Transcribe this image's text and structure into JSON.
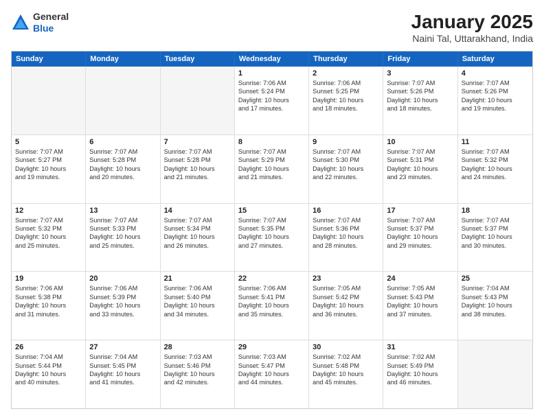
{
  "logo": {
    "general": "General",
    "blue": "Blue"
  },
  "title": "January 2025",
  "subtitle": "Naini Tal, Uttarakhand, India",
  "days": [
    "Sunday",
    "Monday",
    "Tuesday",
    "Wednesday",
    "Thursday",
    "Friday",
    "Saturday"
  ],
  "weeks": [
    [
      {
        "day": "",
        "lines": []
      },
      {
        "day": "",
        "lines": []
      },
      {
        "day": "",
        "lines": []
      },
      {
        "day": "1",
        "lines": [
          "Sunrise: 7:06 AM",
          "Sunset: 5:24 PM",
          "Daylight: 10 hours",
          "and 17 minutes."
        ]
      },
      {
        "day": "2",
        "lines": [
          "Sunrise: 7:06 AM",
          "Sunset: 5:25 PM",
          "Daylight: 10 hours",
          "and 18 minutes."
        ]
      },
      {
        "day": "3",
        "lines": [
          "Sunrise: 7:07 AM",
          "Sunset: 5:26 PM",
          "Daylight: 10 hours",
          "and 18 minutes."
        ]
      },
      {
        "day": "4",
        "lines": [
          "Sunrise: 7:07 AM",
          "Sunset: 5:26 PM",
          "Daylight: 10 hours",
          "and 19 minutes."
        ]
      }
    ],
    [
      {
        "day": "5",
        "lines": [
          "Sunrise: 7:07 AM",
          "Sunset: 5:27 PM",
          "Daylight: 10 hours",
          "and 19 minutes."
        ]
      },
      {
        "day": "6",
        "lines": [
          "Sunrise: 7:07 AM",
          "Sunset: 5:28 PM",
          "Daylight: 10 hours",
          "and 20 minutes."
        ]
      },
      {
        "day": "7",
        "lines": [
          "Sunrise: 7:07 AM",
          "Sunset: 5:28 PM",
          "Daylight: 10 hours",
          "and 21 minutes."
        ]
      },
      {
        "day": "8",
        "lines": [
          "Sunrise: 7:07 AM",
          "Sunset: 5:29 PM",
          "Daylight: 10 hours",
          "and 21 minutes."
        ]
      },
      {
        "day": "9",
        "lines": [
          "Sunrise: 7:07 AM",
          "Sunset: 5:30 PM",
          "Daylight: 10 hours",
          "and 22 minutes."
        ]
      },
      {
        "day": "10",
        "lines": [
          "Sunrise: 7:07 AM",
          "Sunset: 5:31 PM",
          "Daylight: 10 hours",
          "and 23 minutes."
        ]
      },
      {
        "day": "11",
        "lines": [
          "Sunrise: 7:07 AM",
          "Sunset: 5:32 PM",
          "Daylight: 10 hours",
          "and 24 minutes."
        ]
      }
    ],
    [
      {
        "day": "12",
        "lines": [
          "Sunrise: 7:07 AM",
          "Sunset: 5:32 PM",
          "Daylight: 10 hours",
          "and 25 minutes."
        ]
      },
      {
        "day": "13",
        "lines": [
          "Sunrise: 7:07 AM",
          "Sunset: 5:33 PM",
          "Daylight: 10 hours",
          "and 25 minutes."
        ]
      },
      {
        "day": "14",
        "lines": [
          "Sunrise: 7:07 AM",
          "Sunset: 5:34 PM",
          "Daylight: 10 hours",
          "and 26 minutes."
        ]
      },
      {
        "day": "15",
        "lines": [
          "Sunrise: 7:07 AM",
          "Sunset: 5:35 PM",
          "Daylight: 10 hours",
          "and 27 minutes."
        ]
      },
      {
        "day": "16",
        "lines": [
          "Sunrise: 7:07 AM",
          "Sunset: 5:36 PM",
          "Daylight: 10 hours",
          "and 28 minutes."
        ]
      },
      {
        "day": "17",
        "lines": [
          "Sunrise: 7:07 AM",
          "Sunset: 5:37 PM",
          "Daylight: 10 hours",
          "and 29 minutes."
        ]
      },
      {
        "day": "18",
        "lines": [
          "Sunrise: 7:07 AM",
          "Sunset: 5:37 PM",
          "Daylight: 10 hours",
          "and 30 minutes."
        ]
      }
    ],
    [
      {
        "day": "19",
        "lines": [
          "Sunrise: 7:06 AM",
          "Sunset: 5:38 PM",
          "Daylight: 10 hours",
          "and 31 minutes."
        ]
      },
      {
        "day": "20",
        "lines": [
          "Sunrise: 7:06 AM",
          "Sunset: 5:39 PM",
          "Daylight: 10 hours",
          "and 33 minutes."
        ]
      },
      {
        "day": "21",
        "lines": [
          "Sunrise: 7:06 AM",
          "Sunset: 5:40 PM",
          "Daylight: 10 hours",
          "and 34 minutes."
        ]
      },
      {
        "day": "22",
        "lines": [
          "Sunrise: 7:06 AM",
          "Sunset: 5:41 PM",
          "Daylight: 10 hours",
          "and 35 minutes."
        ]
      },
      {
        "day": "23",
        "lines": [
          "Sunrise: 7:05 AM",
          "Sunset: 5:42 PM",
          "Daylight: 10 hours",
          "and 36 minutes."
        ]
      },
      {
        "day": "24",
        "lines": [
          "Sunrise: 7:05 AM",
          "Sunset: 5:43 PM",
          "Daylight: 10 hours",
          "and 37 minutes."
        ]
      },
      {
        "day": "25",
        "lines": [
          "Sunrise: 7:04 AM",
          "Sunset: 5:43 PM",
          "Daylight: 10 hours",
          "and 38 minutes."
        ]
      }
    ],
    [
      {
        "day": "26",
        "lines": [
          "Sunrise: 7:04 AM",
          "Sunset: 5:44 PM",
          "Daylight: 10 hours",
          "and 40 minutes."
        ]
      },
      {
        "day": "27",
        "lines": [
          "Sunrise: 7:04 AM",
          "Sunset: 5:45 PM",
          "Daylight: 10 hours",
          "and 41 minutes."
        ]
      },
      {
        "day": "28",
        "lines": [
          "Sunrise: 7:03 AM",
          "Sunset: 5:46 PM",
          "Daylight: 10 hours",
          "and 42 minutes."
        ]
      },
      {
        "day": "29",
        "lines": [
          "Sunrise: 7:03 AM",
          "Sunset: 5:47 PM",
          "Daylight: 10 hours",
          "and 44 minutes."
        ]
      },
      {
        "day": "30",
        "lines": [
          "Sunrise: 7:02 AM",
          "Sunset: 5:48 PM",
          "Daylight: 10 hours",
          "and 45 minutes."
        ]
      },
      {
        "day": "31",
        "lines": [
          "Sunrise: 7:02 AM",
          "Sunset: 5:49 PM",
          "Daylight: 10 hours",
          "and 46 minutes."
        ]
      },
      {
        "day": "",
        "lines": []
      }
    ]
  ]
}
